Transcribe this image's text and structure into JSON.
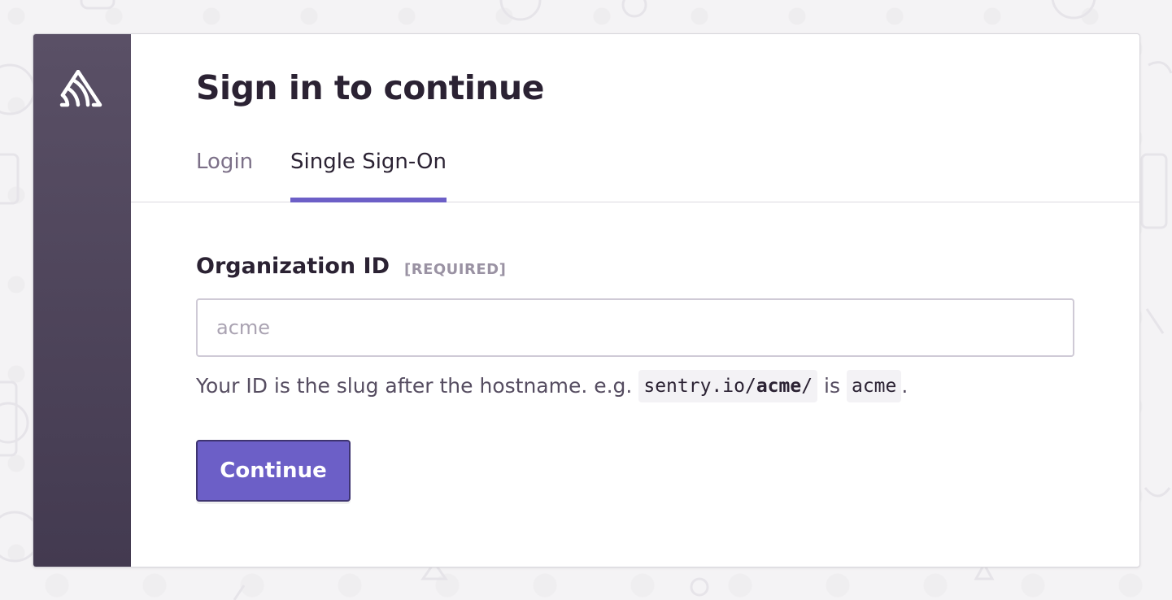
{
  "app": {
    "logo_icon": "sentry-logo-icon"
  },
  "page": {
    "title": "Sign in to continue"
  },
  "tabs": [
    {
      "label": "Login",
      "active": false
    },
    {
      "label": "Single Sign-On",
      "active": true
    }
  ],
  "form": {
    "org_field": {
      "label": "Organization ID",
      "required_tag": "[REQUIRED]",
      "value": "",
      "placeholder": "acme"
    },
    "help": {
      "prefix": "Your ID is the slug after the hostname. e.g.",
      "url_host": "sentry.io/",
      "url_slug": "acme",
      "url_trailing": "/",
      "middle": "is",
      "example_slug": "acme",
      "suffix": "."
    },
    "submit_label": "Continue"
  },
  "colors": {
    "accent": "#6c5fc7",
    "sidebar_top": "#5a5066",
    "sidebar_bottom": "#433a50",
    "text_primary": "#2b2233",
    "text_muted": "#7c7088"
  }
}
